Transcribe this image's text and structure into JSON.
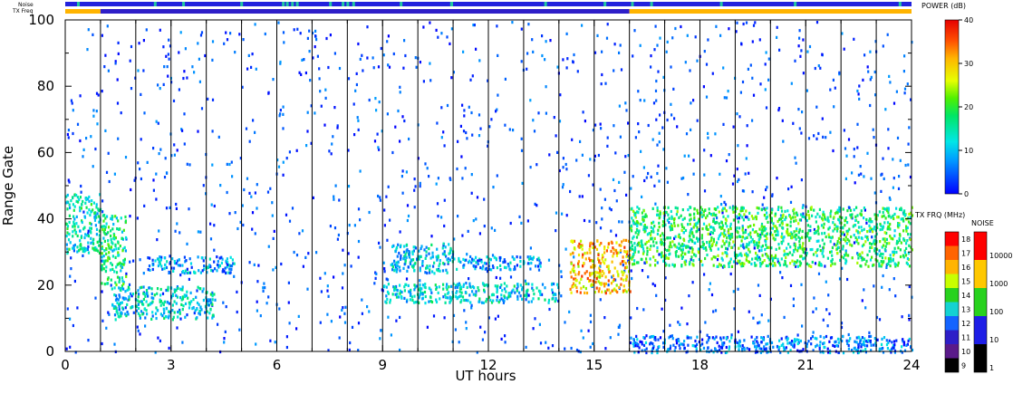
{
  "header": {
    "noise_label": "Noise",
    "txfreq_label": "TX Freq"
  },
  "chart_data": {
    "type": "heatmap",
    "xlabel": "UT hours",
    "ylabel": "Range Gate",
    "xlim": [
      0,
      24
    ],
    "ylim": [
      0,
      100
    ],
    "x_ticks": [
      "0",
      "3",
      "6",
      "9",
      "12",
      "15",
      "18",
      "21",
      "24"
    ],
    "y_ticks": [
      "0",
      "20",
      "40",
      "60",
      "80",
      "100"
    ],
    "scan_boundaries_ut": [
      1.0,
      2.0,
      3.0,
      4.0,
      5.0,
      6.0,
      7.0,
      8.0,
      9.0,
      10.0,
      11.0,
      12.0,
      13.0,
      14.0,
      15.0,
      16.0,
      17.0,
      18.0,
      19.0,
      20.0,
      21.0,
      22.0,
      23.0
    ],
    "scatter_bands": [
      {
        "t0": 0.0,
        "t1": 1.0,
        "g0": 30,
        "g1": 48,
        "power_db": 14
      },
      {
        "t0": 1.0,
        "t1": 1.7,
        "g0": 20,
        "g1": 42,
        "power_db": 16
      },
      {
        "t0": 1.3,
        "t1": 4.2,
        "g0": 10,
        "g1": 20,
        "power_db": 12
      },
      {
        "t0": 2.3,
        "t1": 4.8,
        "g0": 24,
        "g1": 29,
        "power_db": 8
      },
      {
        "t0": 9.2,
        "t1": 11.0,
        "g0": 24,
        "g1": 33,
        "power_db": 11
      },
      {
        "t0": 9.0,
        "t1": 14.0,
        "g0": 15,
        "g1": 21,
        "power_db": 12
      },
      {
        "t0": 11.0,
        "t1": 13.5,
        "g0": 25,
        "g1": 29,
        "power_db": 8
      },
      {
        "t0": 14.3,
        "t1": 16.0,
        "g0": 18,
        "g1": 34,
        "power_db": 30
      },
      {
        "t0": 16.0,
        "t1": 24.0,
        "g0": 26,
        "g1": 44,
        "power_db": 18
      },
      {
        "t0": 16.0,
        "t1": 24.0,
        "g0": 0,
        "g1": 5,
        "power_db": 6
      }
    ],
    "power_colorbar": {
      "label": "POWER (dB)",
      "range": [
        0,
        40
      ],
      "ticks": [
        "0",
        "10",
        "20",
        "30",
        "40"
      ]
    },
    "txfreq_colorbar": {
      "label": "TX FRQ (MHz)",
      "ticks": [
        "9",
        "10",
        "11",
        "12",
        "13",
        "14",
        "15",
        "16",
        "17",
        "18"
      ],
      "colors": [
        "#000000",
        "#5a1a8a",
        "#2e1ec8",
        "#1464ff",
        "#14d2d2",
        "#28d21e",
        "#c8ff00",
        "#ffb400",
        "#ff6400",
        "#ff0000"
      ]
    },
    "noise_colorbar": {
      "label": "NOISE",
      "ticks": [
        "1",
        "10",
        "100",
        "1000",
        "10000"
      ],
      "colors": [
        "#000000",
        "#1e1ee6",
        "#28d21e",
        "#ffc800",
        "#ff0000"
      ]
    },
    "noise_bar": {
      "base_color": "#2222dd",
      "accent_color": "#22c8a0"
    },
    "txfreq_bar": {
      "segments": [
        {
          "t0": 0.0,
          "t1": 1.0,
          "color": "#ffb400"
        },
        {
          "t0": 1.0,
          "t1": 16.0,
          "color": "#2e1ec8"
        },
        {
          "t0": 16.0,
          "t1": 24.0,
          "color": "#ffb400"
        }
      ]
    }
  }
}
